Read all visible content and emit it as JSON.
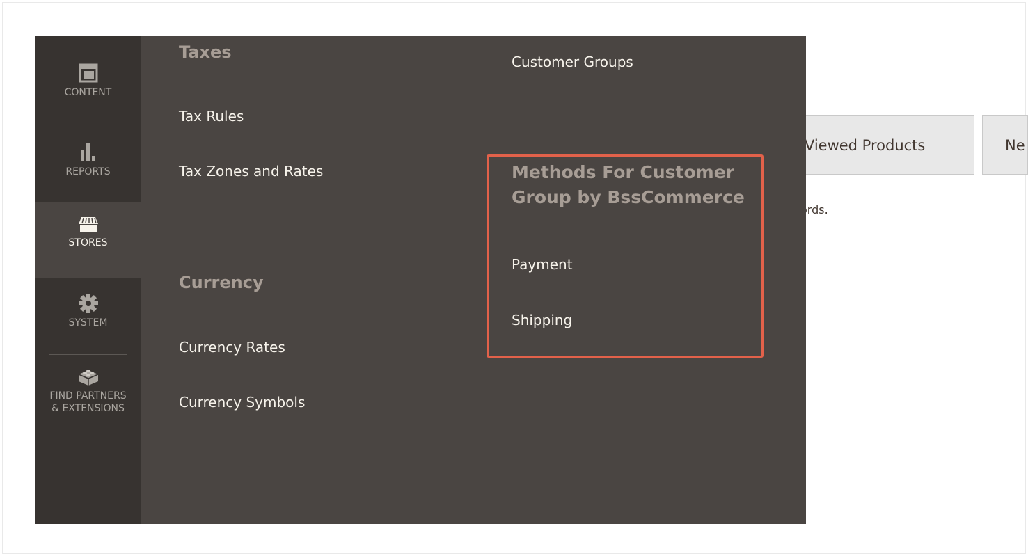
{
  "page": {
    "tabs": [
      {
        "label": "t Viewed Products"
      },
      {
        "label": "Ne"
      }
    ],
    "records_text": "ords."
  },
  "sidebar": {
    "items": [
      {
        "label": "CONTENT",
        "icon": "content-icon"
      },
      {
        "label": "REPORTS",
        "icon": "bar-chart-icon"
      },
      {
        "label": "STORES",
        "icon": "store-icon",
        "active": true
      },
      {
        "label": "SYSTEM",
        "icon": "gear-icon"
      },
      {
        "label_line1": "FIND PARTNERS",
        "label_line2": "& EXTENSIONS",
        "icon": "lego-brick-icon"
      }
    ]
  },
  "flyout": {
    "taxes": {
      "title": "Taxes",
      "links": [
        "Tax Rules",
        "Tax Zones and Rates"
      ]
    },
    "currency": {
      "title": "Currency",
      "links": [
        "Currency Rates",
        "Currency Symbols"
      ]
    },
    "customer_groups_link": "Customer Groups",
    "bss": {
      "title": "Methods For Customer Group by BssCommerce",
      "links": [
        "Payment",
        "Shipping"
      ]
    }
  },
  "colors": {
    "sidebar_bg": "#373330",
    "flyout_bg": "#4a4542",
    "section_title": "#a79d95",
    "link_text": "#f7f3eb",
    "highlight_border": "#e2614a"
  }
}
